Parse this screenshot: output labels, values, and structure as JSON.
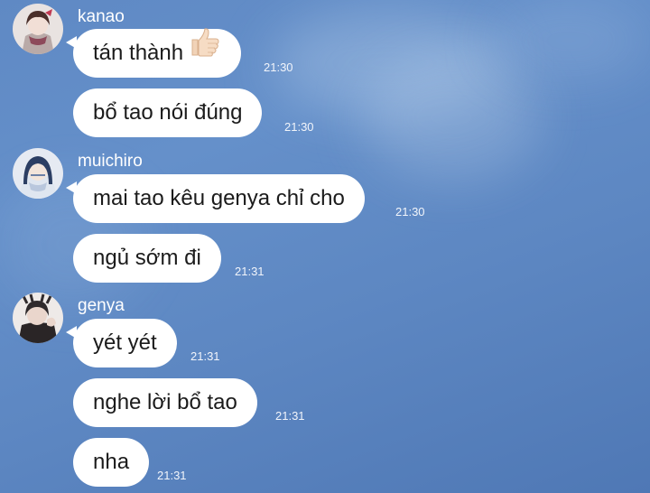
{
  "chat": {
    "groups": [
      {
        "user": "kanao",
        "avatar_icon": "kanao-avatar",
        "messages": [
          {
            "text": "tán thành",
            "emoji": "thumbs-up-icon",
            "time": "21:30"
          },
          {
            "text": "bổ tao nói đúng",
            "time": "21:30"
          }
        ]
      },
      {
        "user": "muichiro",
        "avatar_icon": "muichiro-avatar",
        "messages": [
          {
            "text": "mai tao kêu genya chỉ cho",
            "time": "21:30"
          },
          {
            "text": "ngủ sớm đi",
            "time": "21:31"
          }
        ]
      },
      {
        "user": "genya",
        "avatar_icon": "genya-avatar",
        "messages": [
          {
            "text": "yét yét",
            "time": "21:31"
          },
          {
            "text": "nghe lời bổ tao",
            "time": "21:31"
          },
          {
            "text": "nha",
            "time": "21:31"
          }
        ]
      }
    ]
  },
  "colors": {
    "background": "#5f89c4",
    "bubble": "#ffffff",
    "text": "#1b1b1b",
    "meta_text": "#ffffff"
  }
}
